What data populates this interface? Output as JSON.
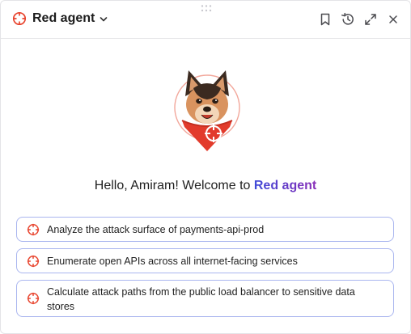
{
  "header": {
    "title": "Red agent",
    "icons": [
      "crosshair-icon",
      "chevron-down-icon",
      "bookmark-icon",
      "history-icon",
      "expand-icon",
      "close-icon"
    ]
  },
  "welcome": {
    "greeting": "Hello, Amiram! Welcome to ",
    "brand": "Red agent"
  },
  "suggestions": [
    {
      "text": "Analyze the attack surface of payments-api-prod"
    },
    {
      "text": "Enumerate open APIs across all internet-facing services"
    },
    {
      "text": "Calculate attack paths from the public load balancer to sensitive data stores"
    }
  ],
  "colors": {
    "accent_red": "#e8452f",
    "suggestion_border": "#aab6ef",
    "brand_gradient_start": "#3f4ad8",
    "brand_gradient_end": "#8a2fb8"
  }
}
